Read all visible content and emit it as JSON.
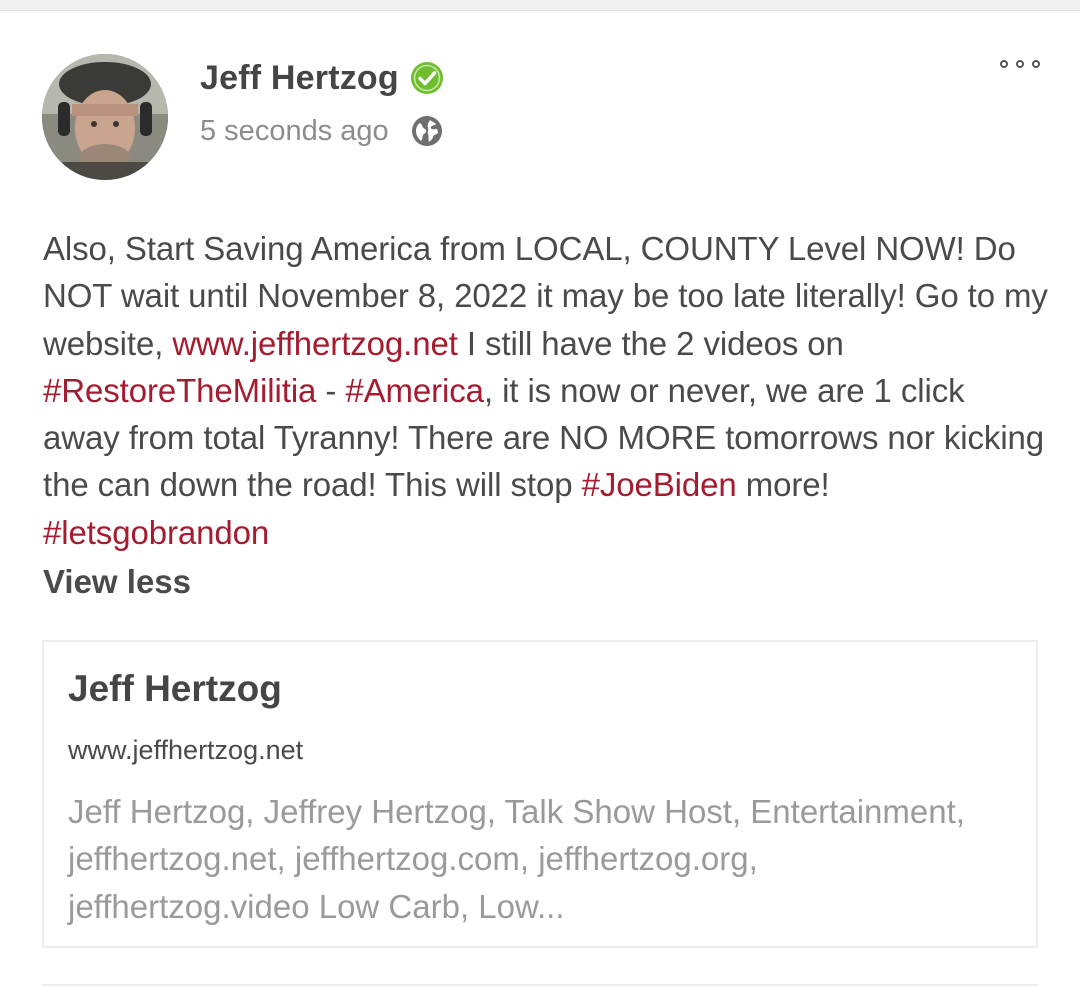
{
  "post": {
    "author": "Jeff Hertzog",
    "timestamp": "5 seconds ago",
    "privacy_icon": "globe-icon",
    "verified_icon": "verified-check-icon",
    "verified_color": "#6fbe2e",
    "more_icon": "more-options-icon",
    "link_color": "#a51c30",
    "text": {
      "p1": "Also, Start Saving America from LOCAL, COUNTY Level NOW! Do NOT wait until November 8, 2022 it may be too late literally! Go to my website, ",
      "link_url": "www.jeffhertzog.net",
      "p2": " I still have the 2 videos on ",
      "tag1": "#RestoreTheMilitia",
      "p3": " - ",
      "tag2": "#America",
      "p4": ", it is now or never, we are 1 click away from total Tyranny! There are NO MORE tomorrows nor kicking the can down the road! This will stop ",
      "tag3": "#JoeBiden",
      "p5": " more! ",
      "tag4": "#letsgobrandon"
    },
    "view_less": "View less"
  },
  "link_preview": {
    "title": "Jeff Hertzog",
    "url": "www.jeffhertzog.net",
    "description": "Jeff Hertzog, Jeffrey Hertzog, Talk Show Host, Entertainment, jeffhertzog.net, jeffhertzog.com, jeffhertzog.org, jeffhertzog.video Low Carb, Low..."
  }
}
